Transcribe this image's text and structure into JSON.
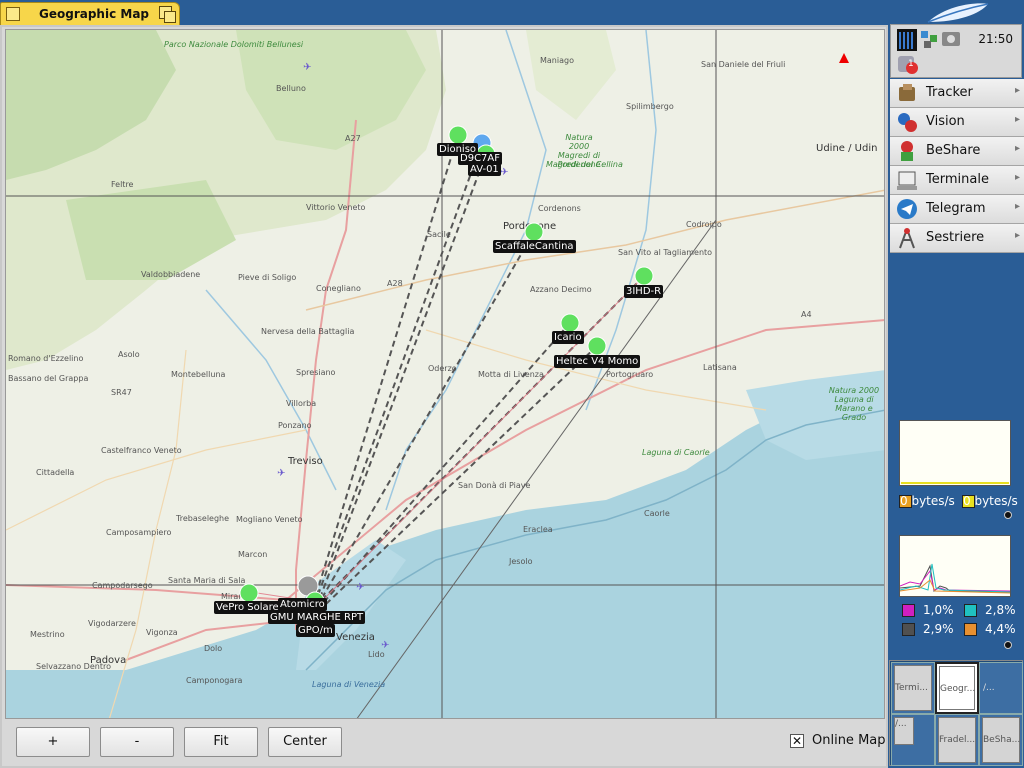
{
  "window": {
    "title": "Geographic Map"
  },
  "map": {
    "place_labels": [
      {
        "text": "Parco Nazionale Dolomiti Bellunesi",
        "kind": "park"
      },
      {
        "text": "Belluno",
        "kind": "city"
      },
      {
        "text": "Maniago",
        "kind": "town"
      },
      {
        "text": "Spilimbergo",
        "kind": "town"
      },
      {
        "text": "San Daniele del Friuli",
        "kind": "town"
      },
      {
        "text": "Udine / Udin",
        "kind": "city"
      },
      {
        "text": "Feltre",
        "kind": "town"
      },
      {
        "text": "Vittorio Veneto",
        "kind": "town"
      },
      {
        "text": "Sacile",
        "kind": "town"
      },
      {
        "text": "Cordenons",
        "kind": "town"
      },
      {
        "text": "Pordenone",
        "kind": "city"
      },
      {
        "text": "Codroipo",
        "kind": "town"
      },
      {
        "text": "San Vito al Tagliamento",
        "kind": "town"
      },
      {
        "text": "Valdobbiadene",
        "kind": "town"
      },
      {
        "text": "Pieve di Soligo",
        "kind": "town"
      },
      {
        "text": "Conegliano",
        "kind": "town"
      },
      {
        "text": "Azzano Decimo",
        "kind": "town"
      },
      {
        "text": "Nervesa della Battaglia",
        "kind": "town"
      },
      {
        "text": "Oderzo",
        "kind": "town"
      },
      {
        "text": "Motta di Livenza",
        "kind": "town"
      },
      {
        "text": "Portogruaro",
        "kind": "town"
      },
      {
        "text": "Latisana",
        "kind": "town"
      },
      {
        "text": "Romano d'Ezzelino",
        "kind": "town"
      },
      {
        "text": "Bassano del Grappa",
        "kind": "town"
      },
      {
        "text": "Asolo",
        "kind": "town"
      },
      {
        "text": "Montebelluna",
        "kind": "town"
      },
      {
        "text": "Spresiano",
        "kind": "town"
      },
      {
        "text": "Villorba",
        "kind": "town"
      },
      {
        "text": "Ponzano",
        "kind": "town"
      },
      {
        "text": "Treviso",
        "kind": "city"
      },
      {
        "text": "Castelfranco Veneto",
        "kind": "town"
      },
      {
        "text": "Cittadella",
        "kind": "town"
      },
      {
        "text": "San Donà di Piave",
        "kind": "town"
      },
      {
        "text": "Eraclea",
        "kind": "town"
      },
      {
        "text": "Caorle",
        "kind": "town"
      },
      {
        "text": "Jesolo",
        "kind": "town"
      },
      {
        "text": "Trebaseleghe",
        "kind": "town"
      },
      {
        "text": "Camposampiero",
        "kind": "town"
      },
      {
        "text": "Mogliano Veneto",
        "kind": "town"
      },
      {
        "text": "Marcon",
        "kind": "town"
      },
      {
        "text": "Santa Maria di Sala",
        "kind": "town"
      },
      {
        "text": "Mirano",
        "kind": "town"
      },
      {
        "text": "Campodarsego",
        "kind": "town"
      },
      {
        "text": "Vigodarzere",
        "kind": "town"
      },
      {
        "text": "Mestrino",
        "kind": "town"
      },
      {
        "text": "Padova",
        "kind": "city"
      },
      {
        "text": "Vigonza",
        "kind": "town"
      },
      {
        "text": "Dolo",
        "kind": "town"
      },
      {
        "text": "Venezia",
        "kind": "city"
      },
      {
        "text": "Lido",
        "kind": "town"
      },
      {
        "text": "Selvazzano Dentro",
        "kind": "town"
      },
      {
        "text": "Camponogara",
        "kind": "town"
      },
      {
        "text": "Laguna di Venezia",
        "kind": "sea"
      },
      {
        "text": "Laguna di Caorle",
        "kind": "park"
      },
      {
        "text": "Natura 2000 Laguna di Marano e Grado",
        "kind": "park"
      },
      {
        "text": "Natura 2000 Magredi di Pordenone",
        "kind": "park"
      },
      {
        "text": "Magredi del Cellina",
        "kind": "park"
      },
      {
        "text": "A27",
        "kind": "road"
      },
      {
        "text": "A28",
        "kind": "road"
      },
      {
        "text": "A4",
        "kind": "road"
      },
      {
        "text": "SR47",
        "kind": "road"
      }
    ],
    "nodes": [
      {
        "label": "Dioniso",
        "color": "#5fe05f"
      },
      {
        "label": "D9C7AF",
        "color": "#5fa8ee"
      },
      {
        "label": "AV-01",
        "color": "#5fe05f"
      },
      {
        "label": "ScaffaleCantina",
        "color": "#5fe05f"
      },
      {
        "label": "3IHD-R",
        "color": "#5fe05f"
      },
      {
        "label": "Icario",
        "color": "#5fe05f"
      },
      {
        "label": "Heltec V4 Momo",
        "color": "#5fe05f"
      },
      {
        "label": "VePro Solare",
        "color": "#5fe05f"
      },
      {
        "label": "Atomicro",
        "color": "#9a9a9a"
      },
      {
        "label": "GMU MARGHE RPT",
        "color": "#5fe05f"
      },
      {
        "label": "GPO/m",
        "color": "#5fa8ee"
      }
    ]
  },
  "buttons": {
    "zoom_in": "+",
    "zoom_out": "-",
    "fit": "Fit",
    "center": "Center"
  },
  "online_map": {
    "label": "Online Map",
    "checked_mark": "✕",
    "checked": true
  },
  "deskbar": {
    "clock": "21:50",
    "notification_count": "1",
    "menu": [
      {
        "label": "Tracker",
        "icon": "tracker-icon"
      },
      {
        "label": "Vision",
        "icon": "vision-icon"
      },
      {
        "label": "BeShare",
        "icon": "beshare-icon"
      },
      {
        "label": "Terminale",
        "icon": "terminal-icon"
      },
      {
        "label": "Telegram",
        "icon": "telegram-icon"
      },
      {
        "label": "Sestriere",
        "icon": "sestriere-icon"
      }
    ],
    "arrow": "▸",
    "network": {
      "in_label": "0 bytes/s",
      "out_label": "0 bytes/s",
      "in_color": "#e8a020",
      "out_color": "#e8e020"
    },
    "cpu": {
      "values": [
        {
          "label": "1,0%",
          "color": "#d020c0"
        },
        {
          "label": "2,8%",
          "color": "#20c0c0"
        },
        {
          "label": "2,9%",
          "color": "#505050"
        },
        {
          "label": "4,4%",
          "color": "#e89030"
        }
      ]
    },
    "workspaces": [
      {
        "label": "Termi..."
      },
      {
        "label": "Geogr..."
      },
      {
        "label": "/..."
      },
      {
        "label": "/..."
      },
      {
        "label": "Fradel..."
      },
      {
        "label": "BeSha..."
      }
    ]
  }
}
